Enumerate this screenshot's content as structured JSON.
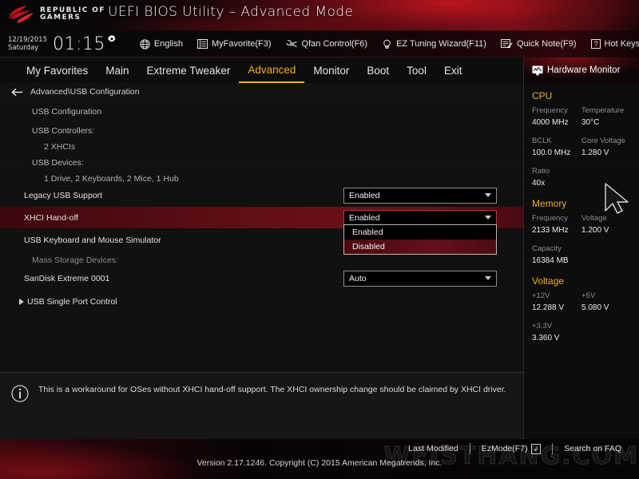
{
  "banner": {
    "brand_line1": "REPUBLIC OF",
    "brand_line2": "GAMERS",
    "title": "UEFI BIOS Utility – Advanced Mode"
  },
  "toolbar": {
    "date": "12/19/2015",
    "weekday": "Saturday",
    "time": "01:15",
    "gear_icon": "gear-icon",
    "items": [
      {
        "label": "English",
        "icon": "globe-icon"
      },
      {
        "label": "MyFavorite(F3)",
        "icon": "list-icon"
      },
      {
        "label": "Qfan Control(F6)",
        "icon": "fan-icon"
      },
      {
        "label": "EZ Tuning Wizard(F11)",
        "icon": "wizard-icon"
      },
      {
        "label": "Quick Note(F9)",
        "icon": "note-icon"
      },
      {
        "label": "Hot Keys",
        "icon": "question-key-icon"
      }
    ]
  },
  "tabs": [
    {
      "label": "My Favorites",
      "active": false
    },
    {
      "label": "Main",
      "active": false
    },
    {
      "label": "Extreme Tweaker",
      "active": false
    },
    {
      "label": "Advanced",
      "active": true
    },
    {
      "label": "Monitor",
      "active": false
    },
    {
      "label": "Boot",
      "active": false
    },
    {
      "label": "Tool",
      "active": false
    },
    {
      "label": "Exit",
      "active": false
    }
  ],
  "breadcrumb": {
    "back_icon": "arrow-left-icon",
    "path": "Advanced\\USB Configuration"
  },
  "content": {
    "heading": "USB Configuration",
    "controllers_label": "USB Controllers:",
    "controllers_value": "2 XHCIs",
    "devices_label": "USB Devices:",
    "devices_value": "1 Drive, 2 Keyboards, 2 Mice, 1 Hub",
    "rows": [
      {
        "label": "Legacy USB Support",
        "value": "Enabled",
        "selected": false,
        "has_combo": true
      },
      {
        "label": "XHCI Hand-off",
        "value": "Enabled",
        "selected": true,
        "has_combo": true
      },
      {
        "label": "USB Keyboard and Mouse Simulator",
        "value": "",
        "selected": false,
        "has_combo": false
      }
    ],
    "mass_storage_label": "Mass Storage Devices:",
    "storage_row": {
      "label": "SanDisk Extreme 0001",
      "value": "Auto"
    },
    "single_port": {
      "label": "USB Single Port Control",
      "icon": "expand-triangle-icon"
    },
    "open_dropdown": {
      "for_row": "XHCI Hand-off",
      "options": [
        {
          "label": "Enabled",
          "highlighted": false
        },
        {
          "label": "Disabled",
          "highlighted": true
        }
      ]
    }
  },
  "help": {
    "icon": "info-icon",
    "text": "This is a workaround for OSes without XHCI hand-off support. The XHCI ownership change should be claimed by XHCI driver."
  },
  "hardware_monitor": {
    "title": "Hardware Monitor",
    "title_icon": "monitor-icon",
    "sections": [
      {
        "name": "CPU",
        "pairs": [
          {
            "k1": "Frequency",
            "v1": "4000 MHz",
            "k2": "Temperature",
            "v2": "30°C"
          },
          {
            "k1": "BCLK",
            "v1": "100.0 MHz",
            "k2": "Core Voltage",
            "v2": "1.280 V"
          },
          {
            "k1": "Ratio",
            "v1": "40x",
            "k2": "",
            "v2": ""
          }
        ]
      },
      {
        "name": "Memory",
        "pairs": [
          {
            "k1": "Frequency",
            "v1": "2133 MHz",
            "k2": "Voltage",
            "v2": "1.200 V"
          },
          {
            "k1": "Capacity",
            "v1": "16384 MB",
            "k2": "",
            "v2": ""
          }
        ]
      },
      {
        "name": "Voltage",
        "pairs": [
          {
            "k1": "+12V",
            "v1": "12.288 V",
            "k2": "+5V",
            "v2": "5.080 V"
          },
          {
            "k1": "+3.3V",
            "v1": "3.360 V",
            "k2": "",
            "v2": ""
          }
        ]
      }
    ]
  },
  "footer": {
    "last_modified": "Last Modified",
    "ez_mode": "EzMode(F7)",
    "ez_mode_key": "↲",
    "search_faq": "Search on FAQ",
    "version": "Version 2.17.1246. Copyright (C) 2015 American Megatrends, Inc.",
    "watermark": "WEISTHANG.COM"
  },
  "colors": {
    "accent_gold": "#f0ad20",
    "rog_red": "#7d0f18",
    "selection_red": "#5e0d14",
    "panel_bg": "#101010"
  }
}
